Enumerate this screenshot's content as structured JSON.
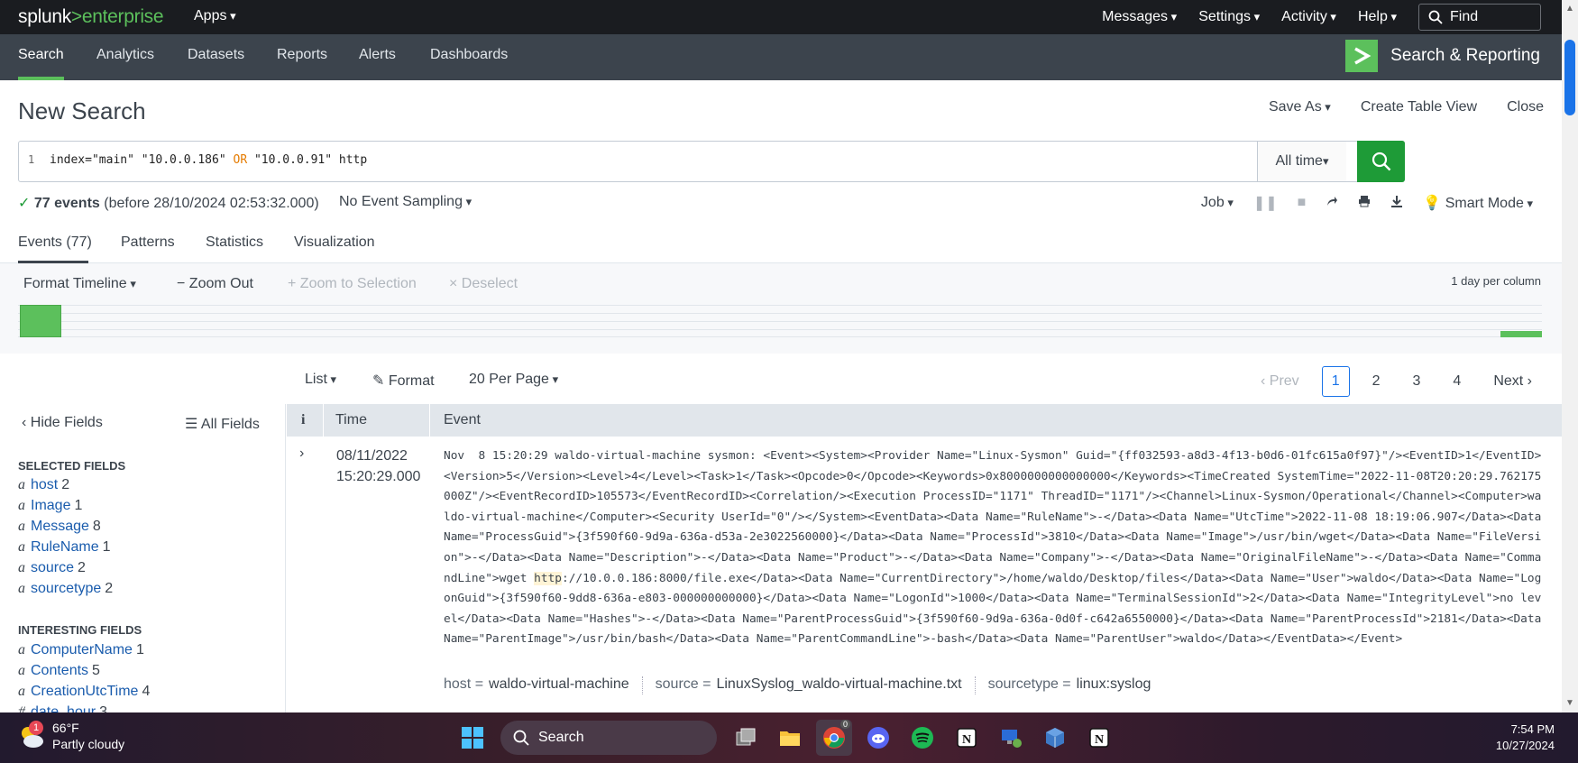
{
  "topbar": {
    "logo_left": "splunk",
    "logo_gt": ">",
    "logo_right": "enterprise",
    "apps": "Apps",
    "menus": [
      "Messages",
      "Settings",
      "Activity",
      "Help"
    ],
    "find_placeholder": "Find"
  },
  "appbar": {
    "nav": [
      "Search",
      "Analytics",
      "Datasets",
      "Reports",
      "Alerts",
      "Dashboards"
    ],
    "app_name": "Search & Reporting"
  },
  "page": {
    "title": "New Search",
    "save_as": "Save As",
    "create_table_view": "Create Table View",
    "close": "Close"
  },
  "search": {
    "line_number": "1",
    "query_part1": "index=\"main\" \"10.0.0.186\" ",
    "query_or": "OR",
    "query_part2": " \"10.0.0.91\" http",
    "time_range": "All time"
  },
  "status": {
    "check": "✓",
    "events": "77 events",
    "before": "(before 28/10/2024 02:53:32.000)",
    "sampling": "No Event Sampling",
    "job": "Job",
    "mode": "Smart Mode"
  },
  "tabs": [
    "Events (77)",
    "Patterns",
    "Statistics",
    "Visualization"
  ],
  "timeline": {
    "format": "Format Timeline",
    "zoom_out": "Zoom Out",
    "zoom_selection": "Zoom to Selection",
    "deselect": "Deselect",
    "per_column": "1 day per column",
    "bars": [
      {
        "position": "first",
        "count": 64
      },
      {
        "position": "last",
        "count": 13
      }
    ]
  },
  "list_controls": {
    "list": "List",
    "format": "Format",
    "per_page": "20 Per Page"
  },
  "pager": {
    "prev": "Prev",
    "pages": [
      "1",
      "2",
      "3",
      "4"
    ],
    "current": "1",
    "next": "Next"
  },
  "fields": {
    "hide": "Hide Fields",
    "all": "All Fields",
    "selected_title": "SELECTED FIELDS",
    "selected": [
      {
        "type": "a",
        "name": "host",
        "count": "2"
      },
      {
        "type": "a",
        "name": "Image",
        "count": "1"
      },
      {
        "type": "a",
        "name": "Message",
        "count": "8"
      },
      {
        "type": "a",
        "name": "RuleName",
        "count": "1"
      },
      {
        "type": "a",
        "name": "source",
        "count": "2"
      },
      {
        "type": "a",
        "name": "sourcetype",
        "count": "2"
      }
    ],
    "interesting_title": "INTERESTING FIELDS",
    "interesting": [
      {
        "type": "a",
        "name": "ComputerName",
        "count": "1"
      },
      {
        "type": "a",
        "name": "Contents",
        "count": "5"
      },
      {
        "type": "a",
        "name": "CreationUtcTime",
        "count": "4"
      },
      {
        "type": "#",
        "name": "date_hour",
        "count": "3"
      }
    ]
  },
  "results": {
    "col_info": "i",
    "col_time": "Time",
    "col_event": "Event",
    "row": {
      "date": "08/11/2022",
      "time": "15:20:29.000",
      "event_pre": "Nov  8 15:20:29 waldo-virtual-machine sysmon: <Event><System><Provider Name=\"Linux-Sysmon\" Guid=\"{ff032593-a8d3-4f13-b0d6-01fc615a0f97}\"/><EventID>1</EventID><Version>5</Version><Level>4</Level><Task>1</Task><Opcode>0</Opcode><Keywords>0x8000000000000000</Keywords><TimeCreated SystemTime=\"2022-11-08T20:20:29.762175000Z\"/><EventRecordID>105573</EventRecordID><Correlation/><Execution ProcessID=\"1171\" ThreadID=\"1171\"/><Channel>Linux-Sysmon/Operational</Channel><Computer>waldo-virtual-machine</Computer><Security UserId=\"0\"/></System><EventData><Data Name=\"RuleName\">-</Data><Data Name=\"UtcTime\">2022-11-08 18:19:06.907</Data><Data Name=\"ProcessGuid\">{3f590f60-9d9a-636a-d53a-2e3022560000}</Data><Data Name=\"ProcessId\">3810</Data><Data Name=\"Image\">/usr/bin/wget</Data><Data Name=\"FileVersion\">-</Data><Data Name=\"Description\">-</Data><Data Name=\"Product\">-</Data><Data Name=\"Company\">-</Data><Data Name=\"OriginalFileName\">-</Data><Data Name=\"CommandLine\">wget ",
      "event_hl": "http",
      "event_post": "://10.0.0.186:8000/file.exe</Data><Data Name=\"CurrentDirectory\">/home/waldo/Desktop/files</Data><Data Name=\"User\">waldo</Data><Data Name=\"LogonGuid\">{3f590f60-9dd8-636a-e803-000000000000}</Data><Data Name=\"LogonId\">1000</Data><Data Name=\"TerminalSessionId\">2</Data><Data Name=\"IntegrityLevel\">no level</Data><Data Name=\"Hashes\">-</Data><Data Name=\"ParentProcessGuid\">{3f590f60-9d9a-636a-0d0f-c642a6550000}</Data><Data Name=\"ParentProcessId\">2181</Data><Data Name=\"ParentImage\">/usr/bin/bash</Data><Data Name=\"ParentCommandLine\">-bash</Data><Data Name=\"ParentUser\">waldo</Data></EventData></Event>",
      "meta": [
        {
          "key": "host =",
          "value": "waldo-virtual-machine"
        },
        {
          "key": "source =",
          "value": "LinuxSyslog_waldo-virtual-machine.txt"
        },
        {
          "key": "sourcetype =",
          "value": "linux:syslog"
        }
      ]
    }
  },
  "taskbar": {
    "weather_badge": "1",
    "temp": "66°F",
    "condition": "Partly cloudy",
    "search": "Search",
    "chrome_badge": "0",
    "time": "7:54 PM",
    "date": "10/27/2024"
  },
  "colors": {
    "splunk_green": "#5cc05c",
    "search_button": "#1e9b37",
    "link_blue": "#1a5cad",
    "appbar": "#3c444d",
    "topbar": "#1a1c20"
  }
}
